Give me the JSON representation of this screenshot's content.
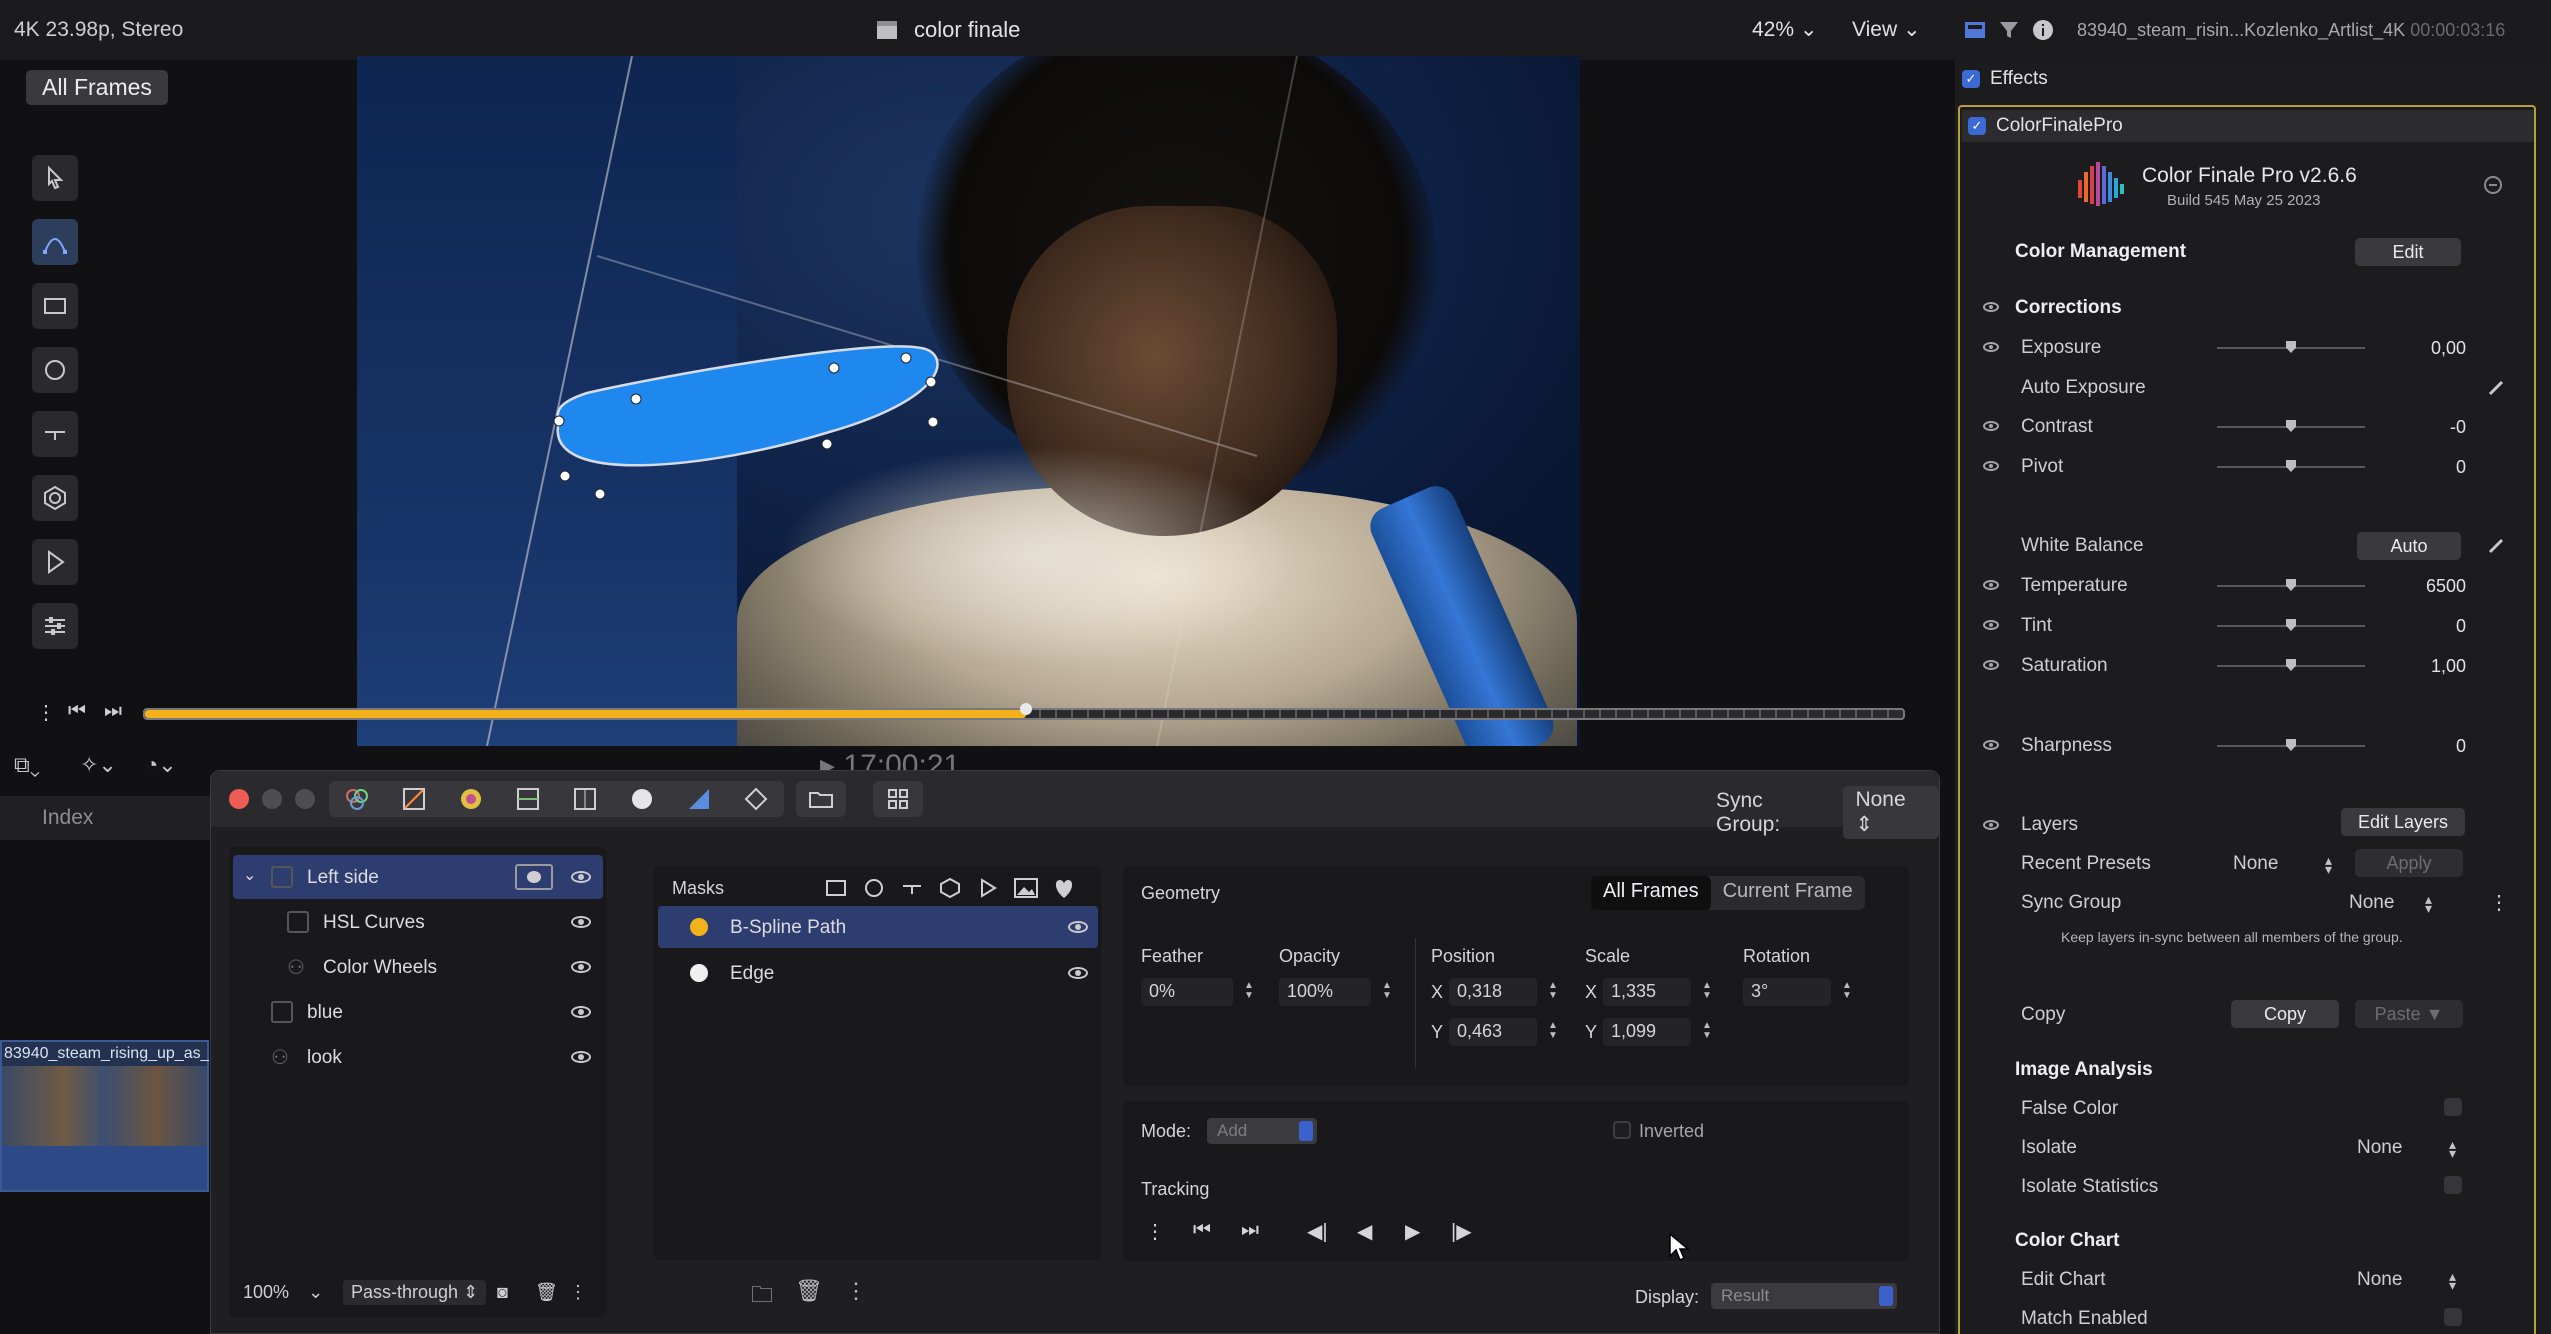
{
  "viewer": {
    "format": "4K 23.98p, Stereo",
    "title": "color finale",
    "zoom": "42%",
    "view": "View",
    "all_frames_badge": "All Frames",
    "timecode": "17:00:21"
  },
  "timeline": {
    "index_label": "Index",
    "clip_name": "83940_steam_rising_up_as_",
    "playhead_fraction": 0.5
  },
  "color_finale_window": {
    "sync_group_label": "Sync Group:",
    "sync_group_value": "None",
    "layers": [
      {
        "name": "Left side",
        "selected": true
      },
      {
        "name": "HSL Curves",
        "selected": false
      },
      {
        "name": "Color Wheels",
        "selected": false
      },
      {
        "name": "blue",
        "selected": false
      },
      {
        "name": "look",
        "selected": false
      }
    ],
    "layers_footer": {
      "opacity": "100%",
      "blend": "Pass-through"
    },
    "masks_label": "Masks",
    "masks": [
      {
        "name": "B-Spline Path",
        "color": "#f2b21c",
        "selected": true
      },
      {
        "name": "Edge",
        "color": "#f0f0f0",
        "selected": false
      }
    ],
    "geometry": {
      "title": "Geometry",
      "seg_all_frames": "All Frames",
      "seg_current_frame": "Current Frame",
      "feather_label": "Feather",
      "feather_value": "0%",
      "opacity_label": "Opacity",
      "opacity_value": "100%",
      "position_label": "Position",
      "pos_x_label": "X",
      "pos_x": "0,318",
      "pos_y_label": "Y",
      "pos_y": "0,463",
      "scale_label": "Scale",
      "scale_x_label": "X",
      "scale_x": "1,335",
      "scale_y_label": "Y",
      "scale_y": "1,099",
      "rotation_label": "Rotation",
      "rotation_value": "3°"
    },
    "mode_label": "Mode:",
    "mode_value": "Add",
    "inverted_label": "Inverted",
    "tracking_label": "Tracking",
    "display_label": "Display:",
    "display_value": "Result"
  },
  "inspector": {
    "clip_title": "83940_steam_risin...Kozlenko_Artlist_4K",
    "duration": "00:00:03:16",
    "effects_label": "Effects",
    "plugin_label": "ColorFinalePro",
    "plugin_name": "Color Finale Pro v2.6.6",
    "plugin_build": "Build 545 May 25 2023",
    "color_management": "Color Management",
    "edit_button": "Edit",
    "corrections": "Corrections",
    "params": [
      {
        "label": "Exposure",
        "value": "0,00",
        "level": 0.5
      },
      {
        "label": "Contrast",
        "value": "-0",
        "level": 0.5
      },
      {
        "label": "Pivot",
        "value": "0",
        "level": 0.5
      },
      {
        "label": "Temperature",
        "value": "6500",
        "level": 0.5
      },
      {
        "label": "Tint",
        "value": "0",
        "level": 0.5
      },
      {
        "label": "Saturation",
        "value": "1,00",
        "level": 0.5
      },
      {
        "label": "Sharpness",
        "value": "0",
        "level": 0.5
      }
    ],
    "auto_exposure": "Auto Exposure",
    "white_balance": "White Balance",
    "auto_button": "Auto",
    "layers_label": "Layers",
    "edit_layers_button": "Edit Layers",
    "recent_presets_label": "Recent Presets",
    "recent_presets_value": "None",
    "apply_button": "Apply",
    "sync_group_label": "Sync Group",
    "sync_group_value": "None",
    "sync_hint": "Keep layers in-sync between all members of the group.",
    "copy_label": "Copy",
    "copy_button": "Copy",
    "paste_button": "Paste",
    "image_analysis": "Image Analysis",
    "false_color": "False Color",
    "isolate": "Isolate",
    "isolate_value": "None",
    "isolate_statistics": "Isolate Statistics",
    "color_chart": "Color Chart",
    "edit_chart": "Edit Chart",
    "edit_chart_value": "None",
    "match_enabled": "Match Enabled"
  },
  "colors": {
    "accent_blue": "#3b69d6",
    "selection": "#2e3d70",
    "playhead_orange": "#f3b21c",
    "plugin_border": "#b99e3a"
  }
}
